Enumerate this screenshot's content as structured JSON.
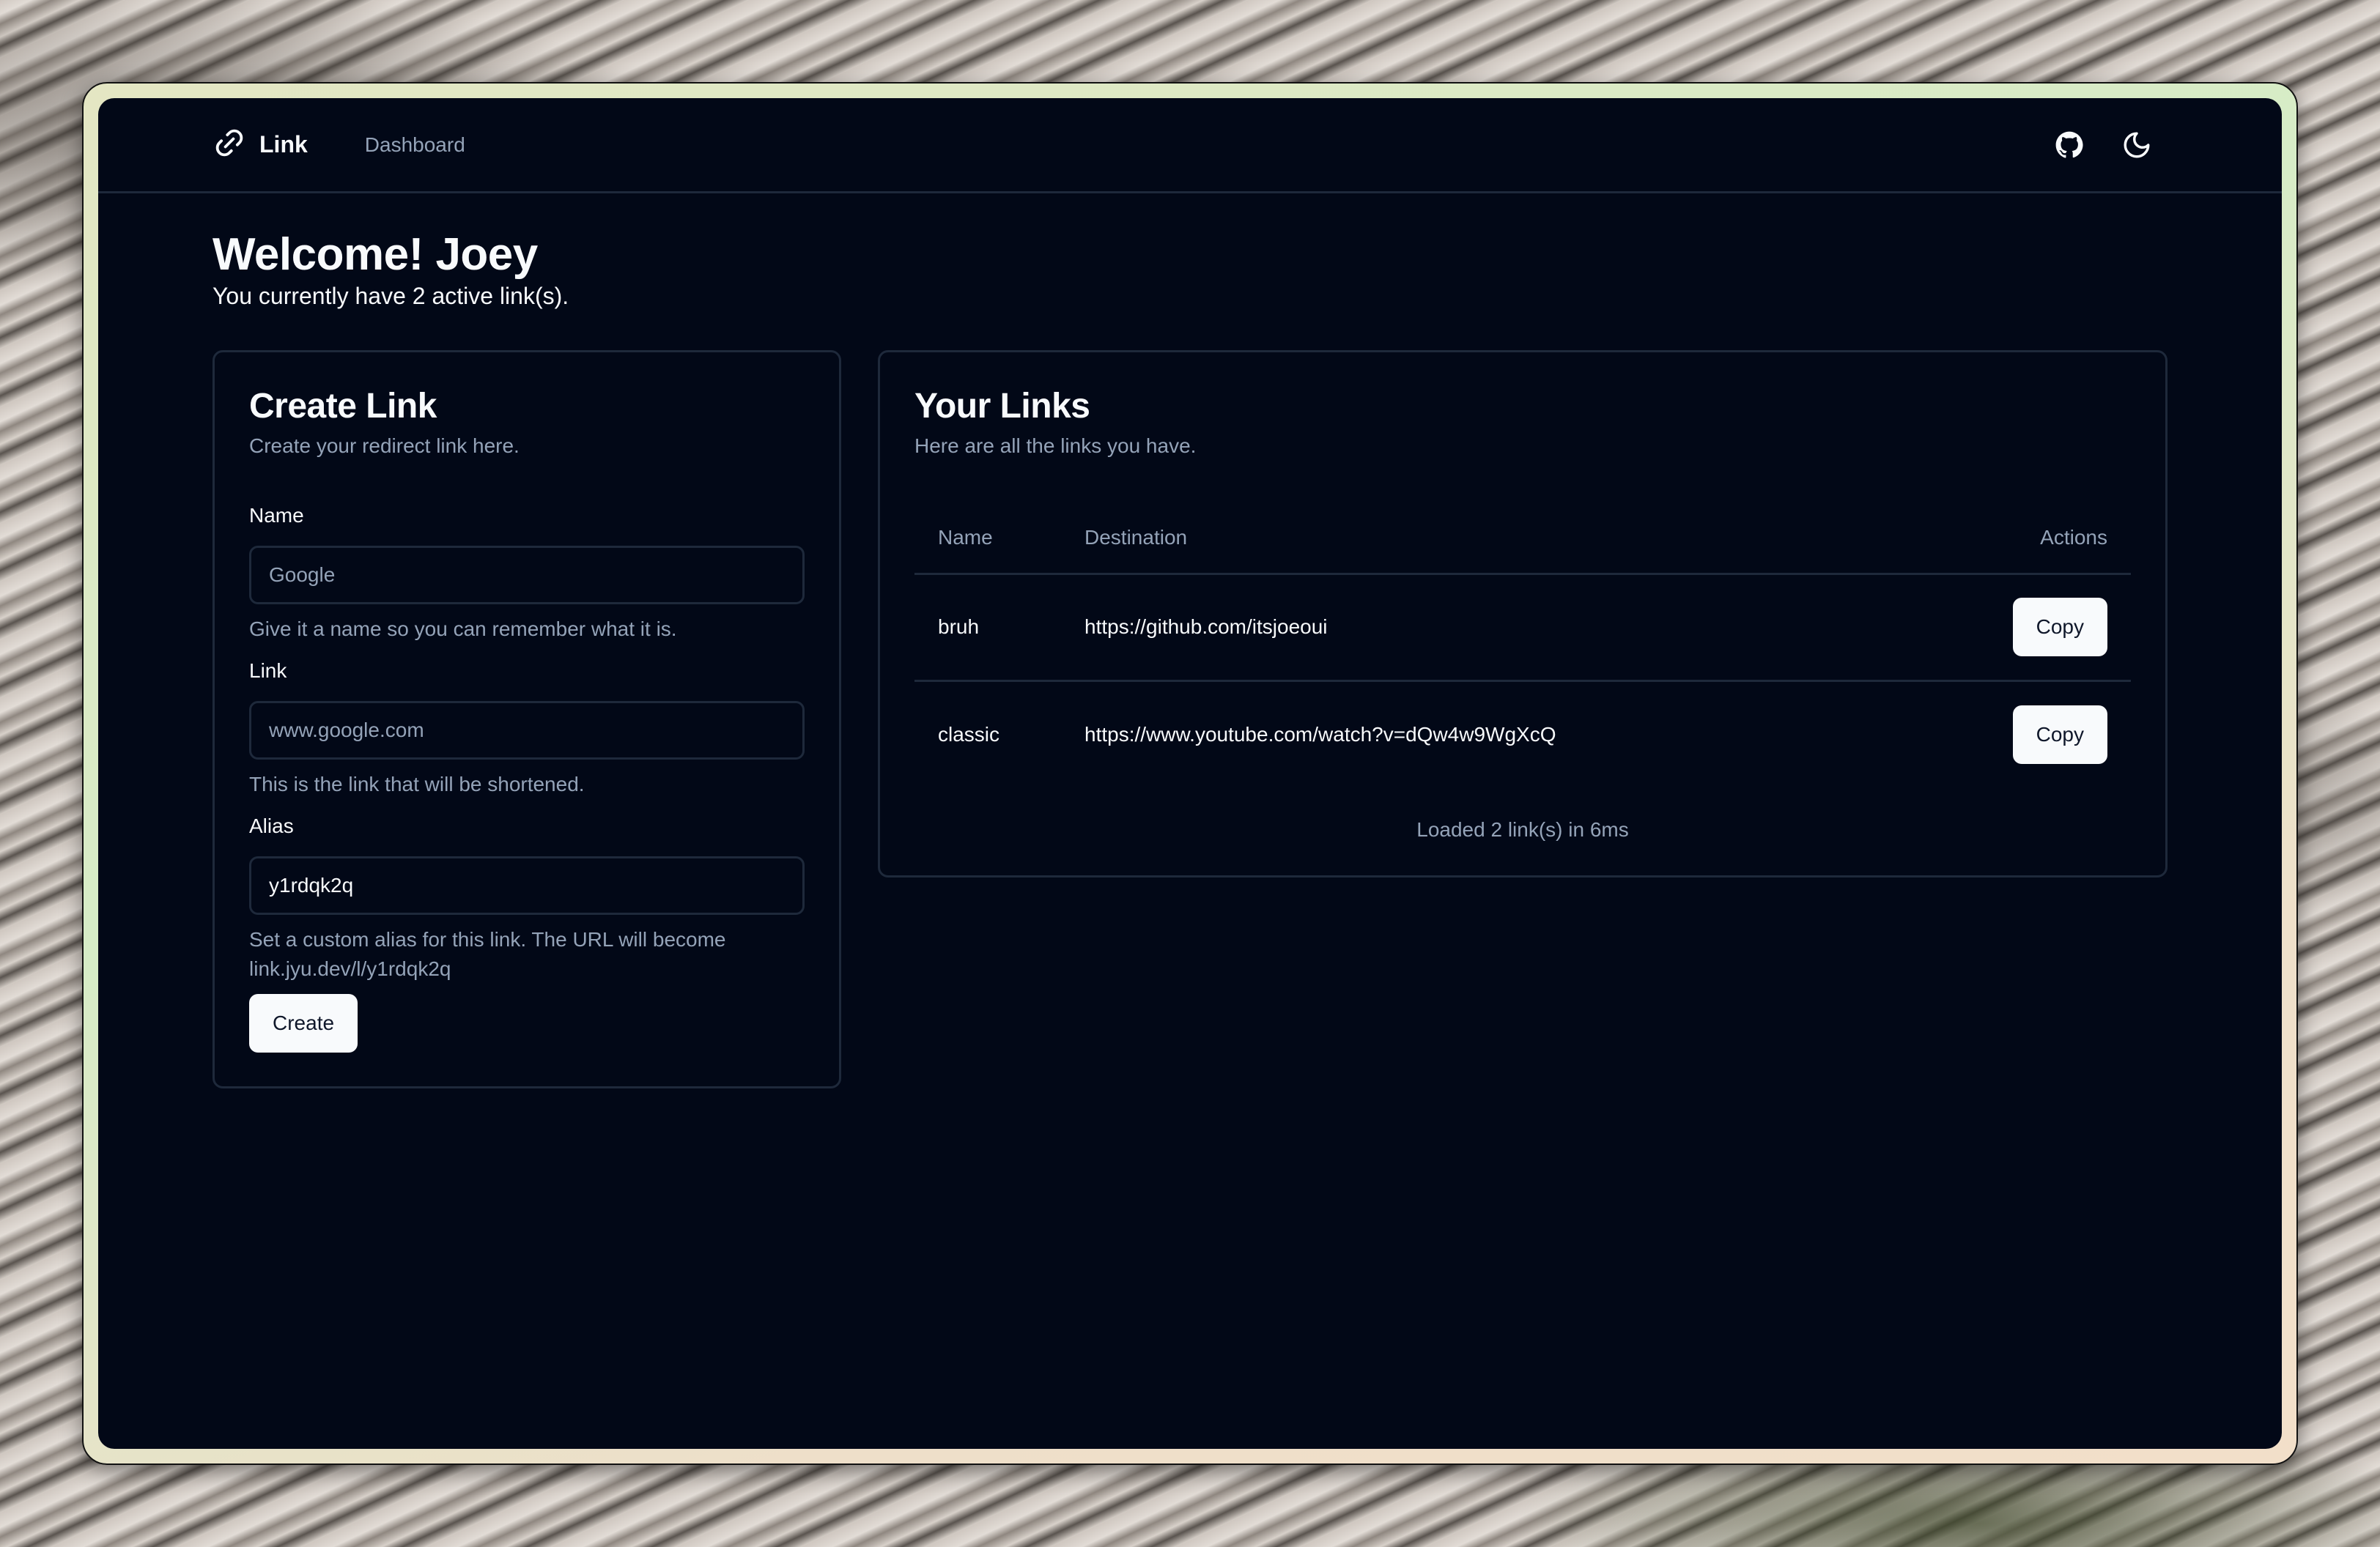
{
  "navbar": {
    "brand": "Link",
    "brand_icon": "link-icon",
    "links": [
      {
        "label": "Dashboard"
      }
    ],
    "github_icon": "github-icon",
    "theme_icon": "moon-icon"
  },
  "welcome": {
    "title": "Welcome! Joey",
    "subtitle": "You currently have 2 active link(s)."
  },
  "create_card": {
    "title": "Create Link",
    "description": "Create your redirect link here.",
    "fields": [
      {
        "label": "Name",
        "value": "",
        "placeholder": "Google",
        "help": "Give it a name so you can remember what it is."
      },
      {
        "label": "Link",
        "value": "",
        "placeholder": "www.google.com",
        "help": "This is the link that will be shortened."
      },
      {
        "label": "Alias",
        "value": "y1rdqk2q",
        "placeholder": "",
        "help": "Set a custom alias for this link. The URL will become link.jyu.dev/l/y1rdqk2q"
      }
    ],
    "submit_label": "Create"
  },
  "links_card": {
    "title": "Your Links",
    "description": "Here are all the links you have.",
    "columns": [
      "Name",
      "Destination",
      "Actions"
    ],
    "rows": [
      {
        "name": "bruh",
        "destination": "https://github.com/itsjoeoui",
        "action": "Copy"
      },
      {
        "name": "classic",
        "destination": "https://www.youtube.com/watch?v=dQw4w9WgXcQ",
        "action": "Copy"
      }
    ],
    "caption": "Loaded 2 link(s) in 6ms"
  },
  "colors": {
    "background": "#020817",
    "foreground": "#f8fafc",
    "muted": "#94a3b8",
    "border": "#1e293b",
    "button_bg": "#f8fafc",
    "button_text": "#0f172a"
  }
}
